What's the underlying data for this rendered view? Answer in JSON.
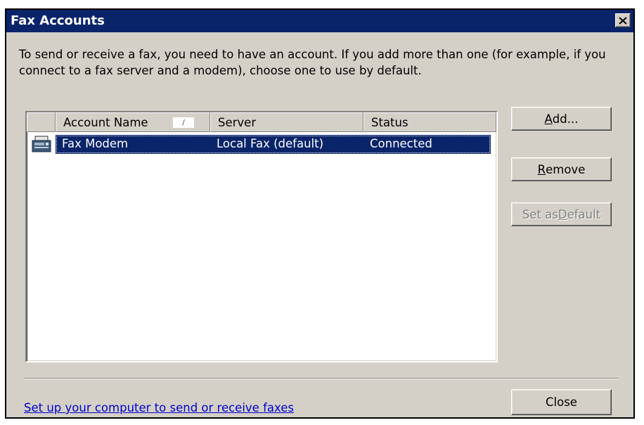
{
  "window": {
    "title": "Fax Accounts"
  },
  "intro_text": "To send or receive a fax, you need to have an account. If you add more than one (for example, if you connect to a fax server and a modem), choose one to use by default.",
  "list": {
    "columns": [
      "Account Name",
      "Server",
      "Status"
    ],
    "sort_indicator": "/",
    "rows": [
      {
        "icon": "fax-machine-icon",
        "name": "Fax Modem",
        "server": "Local Fax (default)",
        "status": "Connected",
        "selected": true
      }
    ]
  },
  "buttons": {
    "add": {
      "pre": "",
      "key": "A",
      "post": "dd..."
    },
    "remove": {
      "pre": "",
      "key": "R",
      "post": "emove"
    },
    "set_default": {
      "pre": "Set as ",
      "key": "D",
      "post": "efault",
      "disabled": true
    },
    "close": "Close"
  },
  "setup_link": "Set up your computer to send or receive faxes",
  "colors": {
    "title_bar": "#0a246a",
    "selection": "#0a246a",
    "face": "#d4d0c8",
    "link": "#0000cc"
  }
}
